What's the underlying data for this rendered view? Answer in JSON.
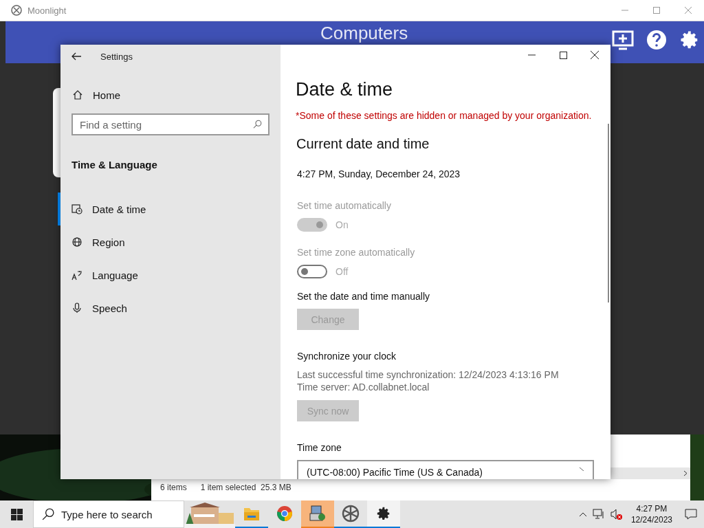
{
  "moonlight": {
    "title": "Moonlight",
    "header": "Computers"
  },
  "settings": {
    "title": "Settings",
    "home": "Home",
    "search": {
      "placeholder": "Find a setting"
    },
    "section": "Time & Language",
    "nav_items": [
      {
        "kind": "clock",
        "label": "Date & time",
        "selected": true
      },
      {
        "kind": "globe",
        "label": "Region",
        "selected": false
      },
      {
        "kind": "language",
        "label": "Language",
        "selected": false
      },
      {
        "kind": "mic",
        "label": "Speech",
        "selected": false
      }
    ],
    "page": {
      "title": "Date & time",
      "notice": "*Some of these settings are hidden or managed by your organization.",
      "heading": "Current date and time",
      "current": "4:27 PM, Sunday, December 24, 2023",
      "rows": [
        {
          "kind": "toggle",
          "label": "Set time automatically",
          "on": true,
          "disabled": true,
          "state": "On"
        },
        {
          "kind": "toggle",
          "label": "Set time zone automatically",
          "on": false,
          "disabled": true,
          "state": "Off"
        },
        {
          "kind": "button",
          "label": "Set the date and time manually",
          "button": "Change",
          "disabled": true
        },
        {
          "kind": "sync",
          "label": "Synchronize your clock",
          "lines": [
            "Last successful time synchronization: 12/24/2023 4:13:16 PM",
            "Time server: AD.collabnet.local"
          ],
          "button": "Sync now",
          "disabled": true
        },
        {
          "kind": "select",
          "label": "Time zone",
          "value": "(UTC-08:00) Pacific Time (US & Canada)"
        }
      ]
    }
  },
  "explorer_status": {
    "count": "6 items",
    "selection": "1 item selected  25.3 MB"
  },
  "taskbar": {
    "search": {
      "placeholder": "Type here to search"
    },
    "apps": [
      {
        "kind": "folder",
        "running": true,
        "flashing": false,
        "focused": false
      },
      {
        "kind": "chrome",
        "running": false,
        "flashing": false,
        "focused": false
      },
      {
        "kind": "remote",
        "running": true,
        "flashing": true,
        "focused": false
      },
      {
        "kind": "wheel",
        "running": true,
        "flashing": false,
        "focused": false
      },
      {
        "kind": "gear",
        "running": true,
        "flashing": false,
        "focused": true
      }
    ],
    "time": "4:27 PM",
    "date": "12/24/2023"
  }
}
